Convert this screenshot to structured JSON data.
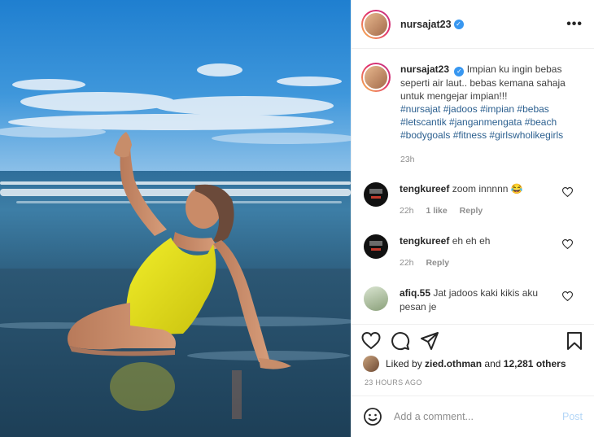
{
  "post": {
    "username": "nursajat23",
    "caption": {
      "username": "nursajat23",
      "text": "Impian ku ingin bebas seperti air laut.. bebas kemana sahaja untuk mengejar impian!!!",
      "hashtags": "#nursajat #jadoos #impian #bebas #letscantik #janganmengata #beach #bodygoals #fitness #girlswholikegirls",
      "time": "23h"
    },
    "comments": [
      {
        "username": "tengkureef",
        "text": "zoom innnnn 😂",
        "time": "22h",
        "likes": "1 like",
        "reply": "Reply"
      },
      {
        "username": "tengkureef",
        "text": "eh eh eh",
        "time": "22h",
        "reply": "Reply"
      },
      {
        "username": "afiq.55",
        "text": "Jat jadoos kaki kikis aku pesan je"
      }
    ],
    "likes": {
      "prefix": "Liked by",
      "user": "zied.othman",
      "and": "and",
      "count": "12,281 others"
    },
    "time_ago": "23 HOURS AGO",
    "add_comment": {
      "placeholder": "Add a comment...",
      "post_label": "Post"
    }
  },
  "icons": {
    "verified": "verified-badge-icon",
    "more": "more-options-icon",
    "like": "heart-icon",
    "comment": "comment-bubble-icon",
    "share": "paper-plane-icon",
    "save": "bookmark-icon",
    "emoji": "smiley-icon"
  },
  "colors": {
    "verified": "#3897f0",
    "hashtag": "#2b5f8f",
    "muted": "#8e8e8e",
    "post_button": "#b3d6f7"
  }
}
